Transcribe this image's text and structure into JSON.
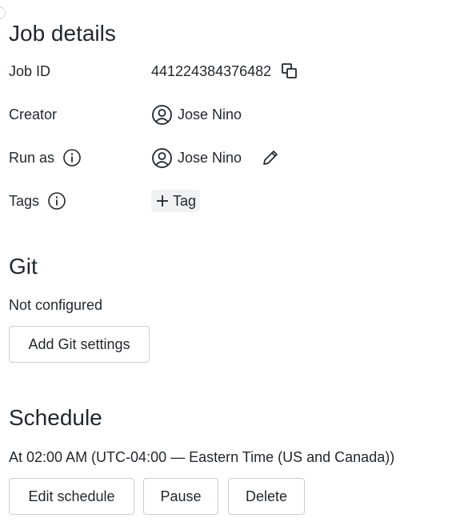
{
  "job_details": {
    "title": "Job details",
    "job_id_label": "Job ID",
    "job_id_value": "441224384376482",
    "creator_label": "Creator",
    "creator_value": "Jose Nino",
    "run_as_label": "Run as",
    "run_as_value": "Jose Nino",
    "tags_label": "Tags",
    "add_tag_label": "Tag",
    "icons": {
      "copy": "copy-icon",
      "user": "user-circle-icon",
      "info": "info-icon",
      "edit": "pencil-icon",
      "add": "plus-icon"
    }
  },
  "git": {
    "title": "Git",
    "status": "Not configured",
    "add_button_label": "Add Git settings"
  },
  "schedule": {
    "title": "Schedule",
    "description": "At 02:00 AM (UTC-04:00 — Eastern Time (US and Canada))",
    "edit_button_label": "Edit schedule",
    "pause_button_label": "Pause",
    "delete_button_label": "Delete"
  },
  "colors": {
    "text": "#1f272d",
    "tag_background": "#f0f2f4",
    "button_border": "#c9ced3"
  }
}
